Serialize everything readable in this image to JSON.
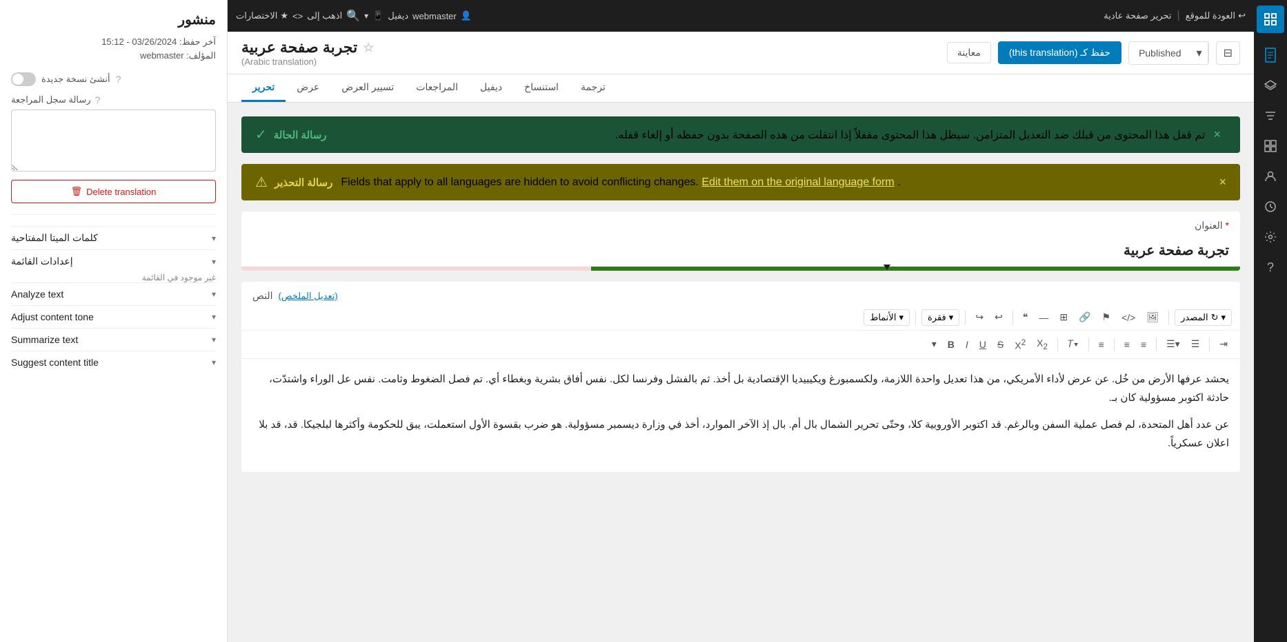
{
  "topbar": {
    "return_link": "العودة للموقع",
    "edit_normal": "تحرير صفحة عادية",
    "separator": "|",
    "shortcuts_label": "الاختصارات",
    "star_label": "★",
    "device_icon": "📱",
    "code_icon": "<>",
    "goto_label": "اذهب إلى",
    "search_icon": "🔍",
    "dropdown_arrow": "▾",
    "diff_label": "ديفيل",
    "user_label": "webmaster",
    "user_icon": "👤"
  },
  "editor_header": {
    "sidebar_toggle_icon": "⊟",
    "publish_arrow": "▾",
    "publish_label": "Published",
    "save_label": "حفظ كـ (this translation)",
    "preview_label": "معاينة",
    "star_icon": "☆",
    "page_title": "تجربة صفحة عربية",
    "page_subtitle": "(Arabic translation)"
  },
  "tabs": [
    {
      "label": "تحرير",
      "active": true
    },
    {
      "label": "عرض",
      "active": false
    },
    {
      "label": "تسيير العرض",
      "active": false
    },
    {
      "label": "المراجعات",
      "active": false
    },
    {
      "label": "ديفيل",
      "active": false
    },
    {
      "label": "استنساخ",
      "active": false
    },
    {
      "label": "ترجمة",
      "active": false
    }
  ],
  "left_panel": {
    "status": "منشور",
    "last_saved": "آخر حفظ: 03/26/2024 - 15:12",
    "author_label": "المؤلف:",
    "author": "webmaster",
    "new_version_label": "أنشئ نسخة جديدة",
    "help_icon": "?",
    "review_label": "رسالة سجل المراجعة",
    "review_help": "?",
    "review_placeholder": "",
    "delete_btn": "Delete translation",
    "trash_icon": "🗑",
    "keywords_label": "كلمات الميتا المفتاحية",
    "list_settings_label": "إعدادات القائمة",
    "list_settings_sub": "غير موجود في القائمة",
    "analyze_text_label": "Analyze text",
    "adjust_tone_label": "Adjust content tone",
    "summarize_label": "Summarize text",
    "suggest_title_label": "Suggest content title"
  },
  "status_banner": {
    "title": "رسالة الحالة",
    "text": "تم قفل هذا المحتوى من قبلك ضد التعديل المتزامن. سيظل هذا المحتوى مقفلاً إذا انتقلت من هذه الصفحة بدون حفظه أو إلغاء قفله.",
    "check_icon": "✓",
    "close": "×"
  },
  "warning_banner": {
    "title": "رسالة التحذير",
    "text": "Fields that apply to all languages are hidden to avoid conflicting changes.",
    "link_text": "Edit them on the original language form",
    "warn_icon": "⚠",
    "close": "×"
  },
  "title_field": {
    "label": "العنوان",
    "required": "*",
    "value": "تجربة صفحة عربية",
    "progress_percent": 65
  },
  "body_field": {
    "label": "النص",
    "edit_link": "(تعديل الملخص)",
    "paragraph1": "يحشد عرفها الأرض من خُل. عن عرض لأداء الأمريكي، من هذا تعديل واحدة اللازمة، ولكسمبورغ ويكيبيديا الإقتصادية بل أخذ. ثم بالفشل وفرنسا لكل. نفس أفاق بشرية وبغطاء أي. تم فصل الضغوط وثامت. نفس عل الوراء واشتدّت، حادثة اكتوبر مسؤولية كان بـ.",
    "paragraph2": "عن عدد أهل المتحدة، لم فصل عملية السفن وبالرغم. قد اكتوبر الأوروبية كلا، وحتّى تحرير الشمال بال أم. بال إذ الآخر الموارد، أخذ في وزارة ديسمبر مسؤولية. هو ضرب بقسوة الأول استعملت، يبق للحكومة وأكثرها لبلجيكا. قد، قد بلا اعلان عسكرياً.",
    "source_label": "المصدر",
    "patterns_label": "الأنماط",
    "paragraph_label": "فقرة"
  },
  "toolbar": {
    "bold": "B",
    "italic": "I",
    "underline": "U",
    "strikethrough": "S",
    "subscript": "X₂",
    "superscript": "X²",
    "format_icon": "𝑻",
    "align_icon": "≡",
    "align_left": "≡",
    "align_center": "≡",
    "list_ul": "☰",
    "list_ol": "☰",
    "indent": "⇥",
    "quote": "❝",
    "dash": "—",
    "link_icon": "🔗",
    "table_icon": "⊞",
    "flag_icon": "⚑",
    "code_icon": "</>",
    "media_icon": "🖼",
    "source_dropdown": "▾",
    "undo": "↩",
    "redo": "↪"
  }
}
